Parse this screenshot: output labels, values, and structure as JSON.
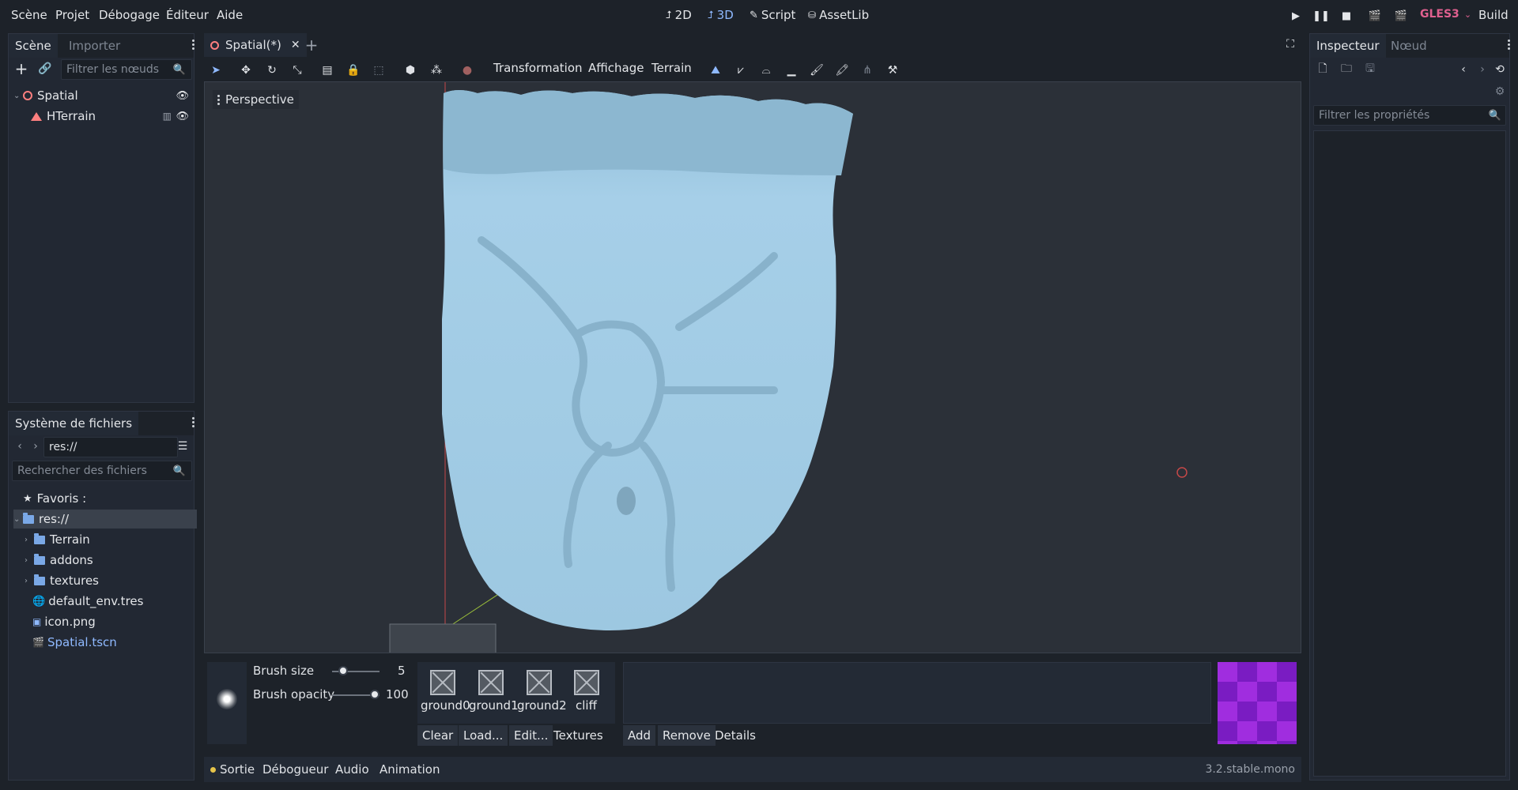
{
  "menu": {
    "items": [
      "Scène",
      "Projet",
      "Débogage",
      "Éditeur",
      "Aide"
    ]
  },
  "workspaces": {
    "items": [
      "2D",
      "3D",
      "Script",
      "AssetLib"
    ],
    "active": "3D"
  },
  "renderer": {
    "label": "GLES3",
    "color": "#e0608f"
  },
  "build_label": "Build",
  "scene_dock": {
    "tab_active": "Scène",
    "tab_inactive": "Importer",
    "filter_placeholder": "Filtrer les nœuds",
    "tree": [
      {
        "label": "Spatial",
        "icon": "spatial-node-icon"
      },
      {
        "label": "HTerrain",
        "icon": "terrain-node-icon"
      }
    ]
  },
  "filesystem": {
    "title": "Système de fichiers",
    "path": "res://",
    "search_placeholder": "Rechercher des fichiers",
    "favorites": "Favoris :",
    "root": "res://",
    "items": [
      {
        "label": "Terrain",
        "type": "folder"
      },
      {
        "label": "addons",
        "type": "folder"
      },
      {
        "label": "textures",
        "type": "folder"
      },
      {
        "label": "default_env.tres",
        "type": "resource"
      },
      {
        "label": "icon.png",
        "type": "image"
      },
      {
        "label": "Spatial.tscn",
        "type": "scene"
      }
    ]
  },
  "editor": {
    "scene_tab": "Spatial(*)",
    "toolbar_menus": [
      "Transformation",
      "Affichage",
      "Terrain"
    ],
    "viewport_label": "Perspective"
  },
  "terrain_panel": {
    "brush_size_label": "Brush size",
    "brush_size_value": "5",
    "brush_size_fraction": 0.16,
    "brush_opacity_label": "Brush opacity",
    "brush_opacity_value": "100",
    "brush_opacity_fraction": 1.0,
    "textures": [
      "ground0",
      "ground1",
      "ground2",
      "cliff"
    ],
    "texture_buttons": [
      "Clear",
      "Load...",
      "Edit...",
      "Textures"
    ],
    "detail_buttons": [
      "Add",
      "Remove",
      "Details"
    ]
  },
  "bottom_bar": {
    "tabs": [
      "Sortie",
      "Débogueur",
      "Audio",
      "Animation"
    ],
    "version": "3.2.stable.mono"
  },
  "inspector": {
    "tab_active": "Inspecteur",
    "tab_inactive": "Nœud",
    "filter_placeholder": "Filtrer les propriétés"
  },
  "colors": {
    "accent": "#8fb9ff",
    "terrain": "#a2cce6",
    "background": "#1d2229",
    "panel": "#222833"
  }
}
